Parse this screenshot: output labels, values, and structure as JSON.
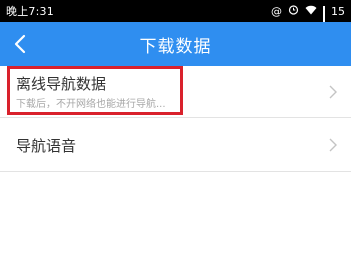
{
  "status_bar": {
    "time": "晚上7:31",
    "icons": [
      "at-icon",
      "alarm-icon",
      "wifi-icon",
      "signal-icon"
    ],
    "battery": "15"
  },
  "header": {
    "title": "下载数据",
    "back_icon": "chevron-left-icon",
    "color": "#2f8ef0"
  },
  "list": {
    "items": [
      {
        "title": "离线导航数据",
        "subtitle": "下载后，不开网络也能进行导航...",
        "chevron_icon": "chevron-right-icon"
      },
      {
        "title": "导航语音",
        "chevron_icon": "chevron-right-icon"
      }
    ]
  },
  "highlight": {
    "color": "#d9212c"
  }
}
